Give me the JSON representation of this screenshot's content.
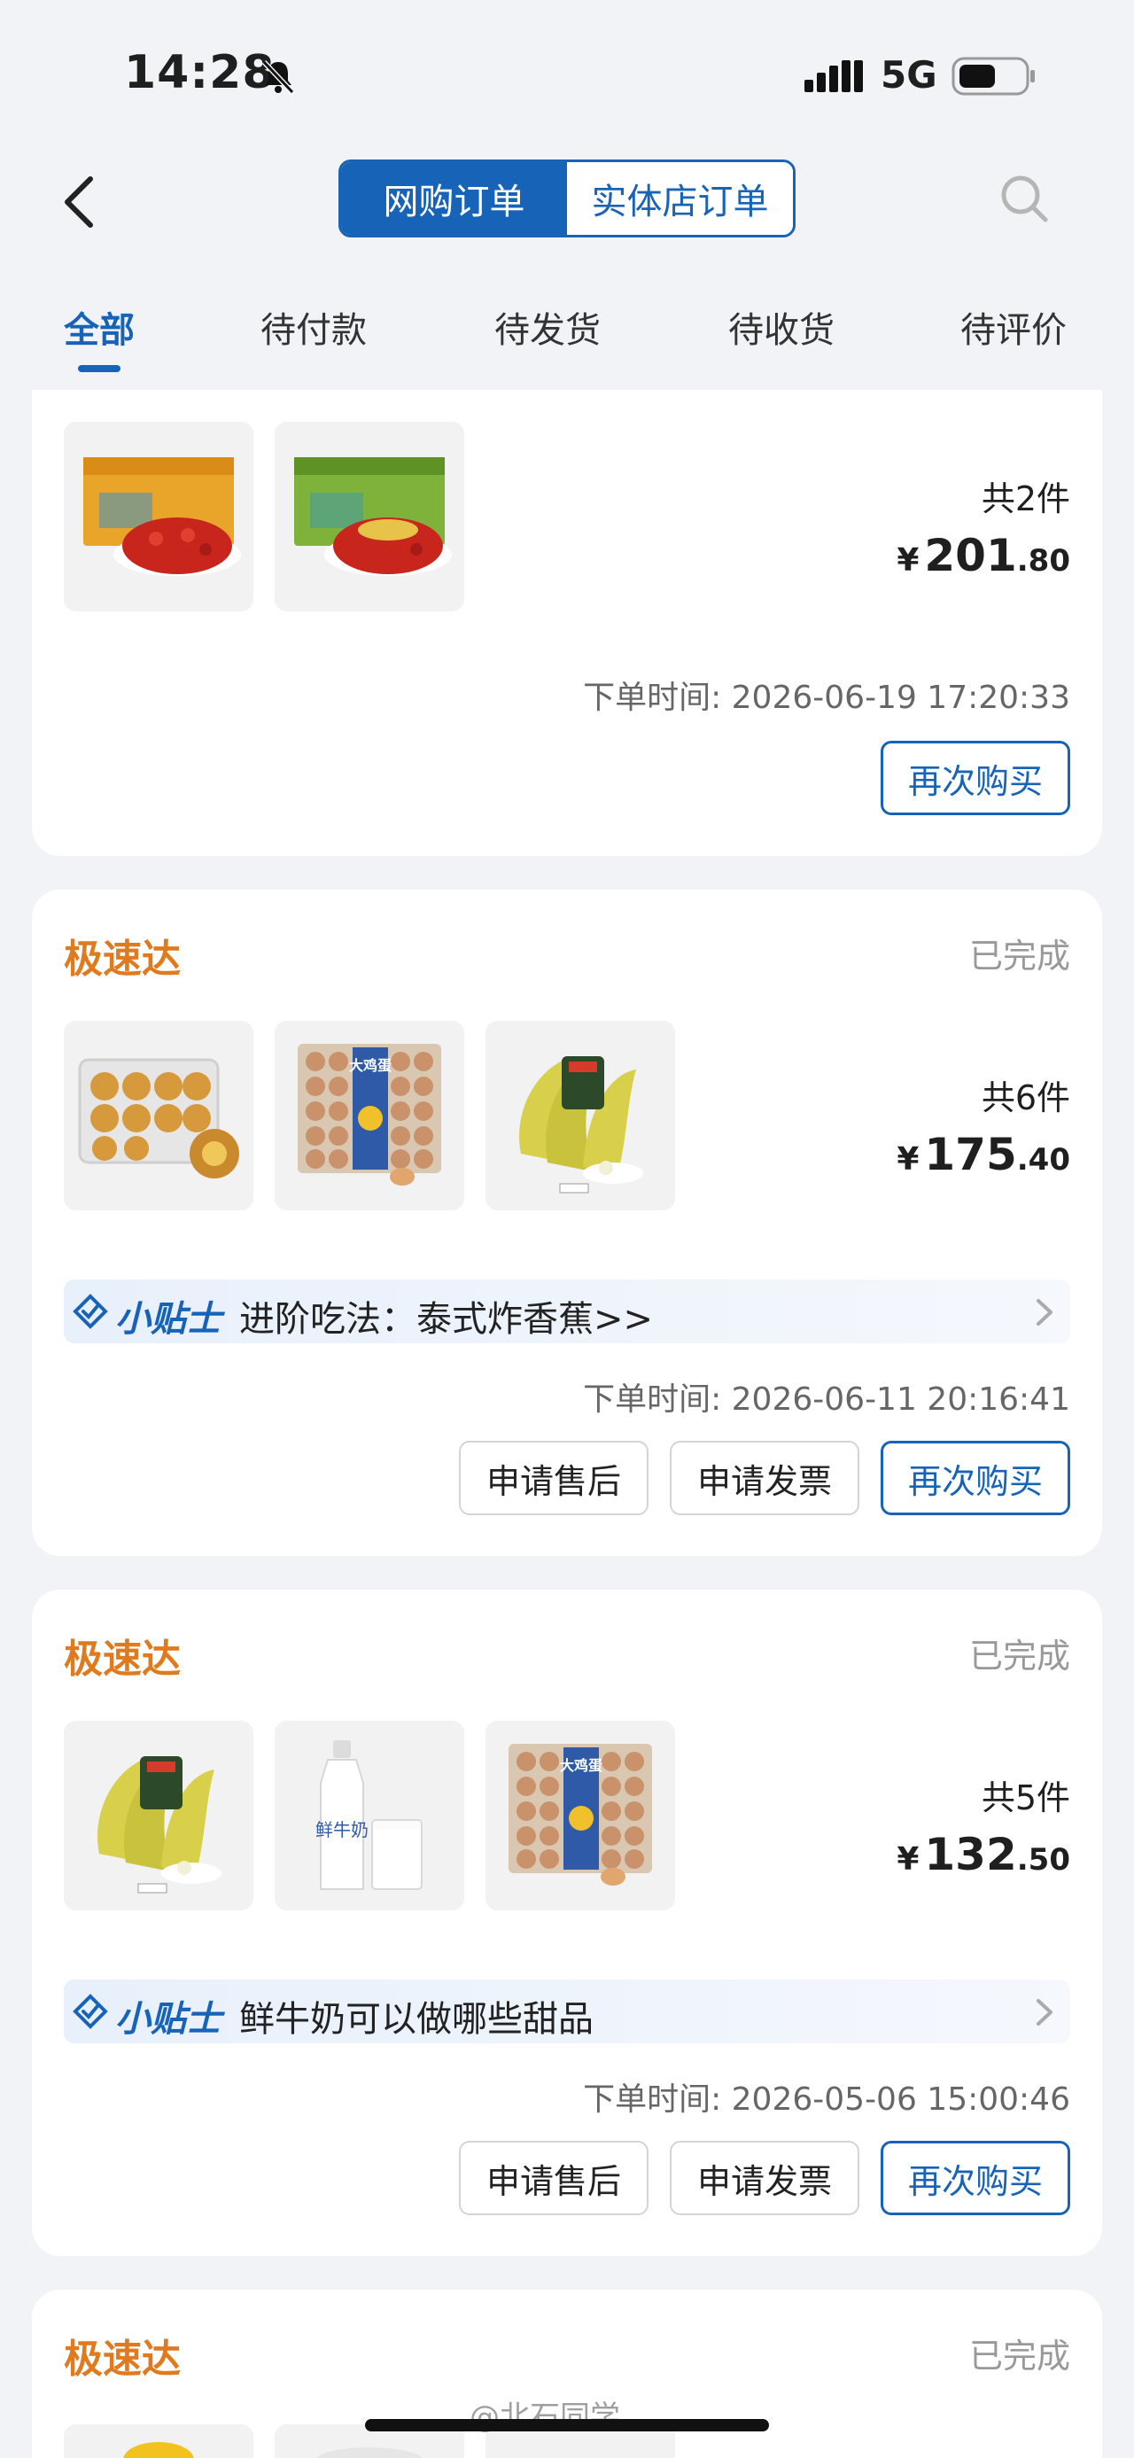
{
  "status_bar": {
    "time": "14:28",
    "network": "5G"
  },
  "nav": {
    "segments": [
      "网购订单",
      "实体店订单"
    ]
  },
  "tabs": [
    "全部",
    "待付款",
    "待发货",
    "待收货",
    "待评价"
  ],
  "orders": [
    {
      "count": "共2件",
      "price_currency": "¥",
      "price_int": "201",
      "price_dec": ".80",
      "order_time": "下单时间: 2026-06-19 17:20:33",
      "buttons": [
        "再次购买"
      ]
    },
    {
      "store": "极速达",
      "status": "已完成",
      "count": "共6件",
      "price_currency": "¥",
      "price_int": "175",
      "price_dec": ".40",
      "tip_label": "小贴士",
      "tip_text": "进阶吃法：泰式炸香蕉>>",
      "order_time": "下单时间: 2026-06-11 20:16:41",
      "buttons": [
        "申请售后",
        "申请发票",
        "再次购买"
      ]
    },
    {
      "store": "极速达",
      "status": "已完成",
      "count": "共5件",
      "price_currency": "¥",
      "price_int": "132",
      "price_dec": ".50",
      "tip_label": "小贴士",
      "tip_text": "鲜牛奶可以做哪些甜品",
      "order_time": "下单时间: 2026-05-06 15:00:46",
      "buttons": [
        "申请售后",
        "申请发票",
        "再次购买"
      ]
    },
    {
      "store": "极速达",
      "status": "已完成"
    }
  ],
  "product_labels": {
    "eggs_brand": "大鸡蛋",
    "milk_brand": "鲜牛奶"
  },
  "watermark": "@北石同学",
  "colors": {
    "accent": "#1763b8",
    "store_orange": "#e07a1f",
    "background": "#f1f3f7"
  }
}
